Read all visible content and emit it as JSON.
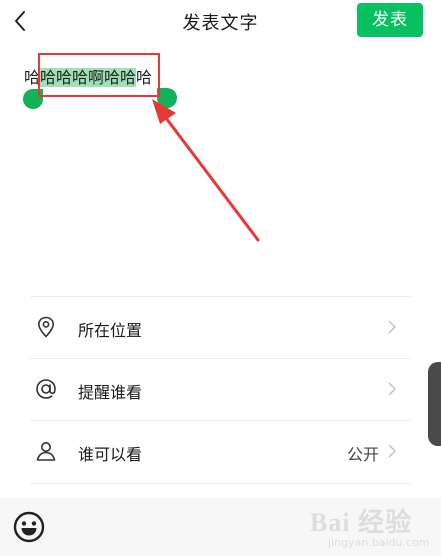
{
  "header": {
    "title": "发表文字",
    "publish_label": "发表"
  },
  "editor": {
    "text_before": "哈",
    "text_selected": "哈哈哈啊哈哈",
    "text_after": "哈"
  },
  "options": [
    {
      "label": "所在位置",
      "icon": "location-pin-icon"
    },
    {
      "label": "提醒谁看",
      "icon": "at-icon"
    },
    {
      "label": "谁可以看",
      "icon": "person-icon",
      "value": "公开"
    }
  ],
  "bottombar": {
    "icon": "emoji-icon"
  },
  "watermark": {
    "main": "Bai 经验",
    "sub": "jingyan.baidu.com"
  },
  "colors": {
    "accent": "#07c160",
    "selection": "#9ee0b8",
    "annotation": "#e53935"
  }
}
